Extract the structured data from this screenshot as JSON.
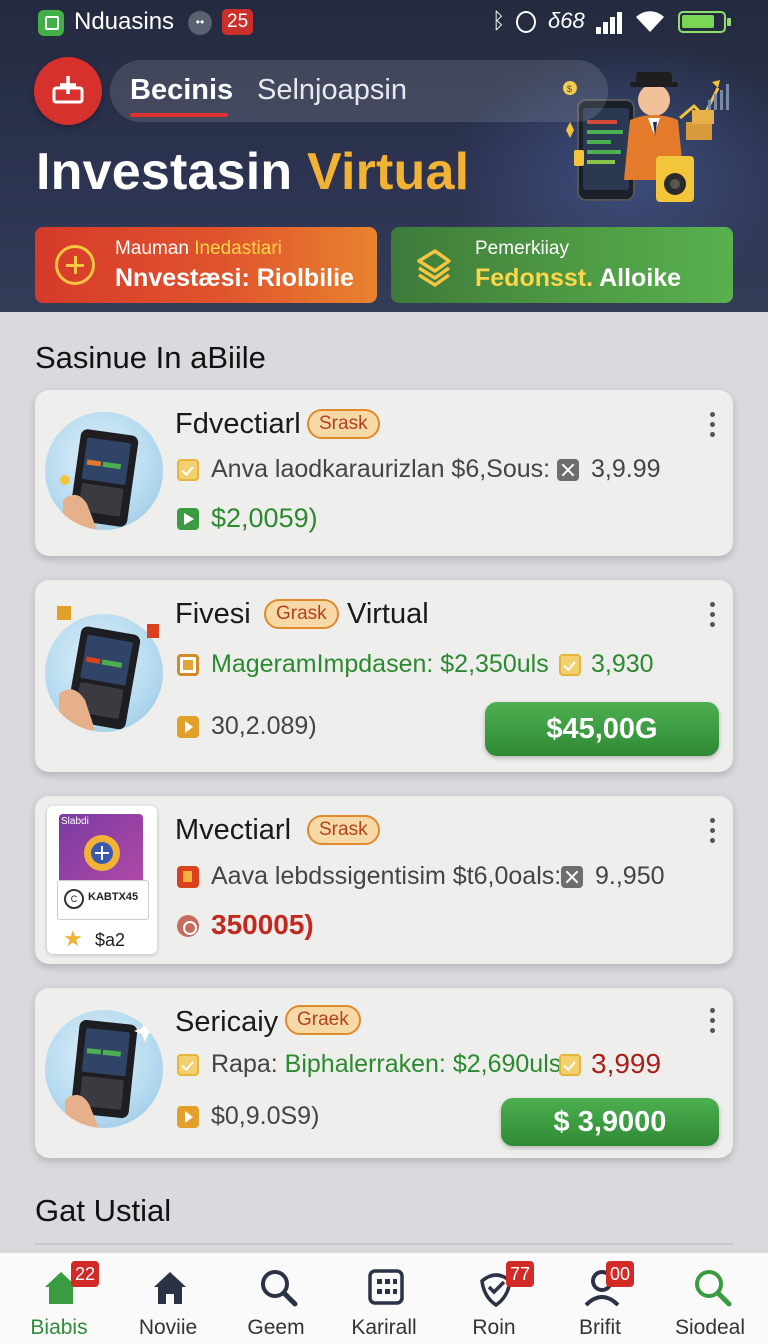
{
  "status_bar": {
    "app_name": "Nduasins",
    "dots": "••",
    "badge": "25",
    "time": "δ68"
  },
  "header": {
    "tabs": [
      {
        "label": "Becinis",
        "active": true
      },
      {
        "label": "Selnjoapsin",
        "active": false
      }
    ],
    "title_main": "Investasin",
    "title_accent": "Virtual",
    "accent_color": "#f2b233",
    "promos": [
      {
        "line1_prefix": "Mauman",
        "line1_highlight": "Inedastiari",
        "line2": "Nnvestæsi: Riolbilie",
        "icon": "plus-circle-icon",
        "color": "#d63a2a"
      },
      {
        "line1": "Pemerkiiay",
        "line2_highlight": "Fedonsst.",
        "line2_rest": "Alloike",
        "icon": "layers-icon",
        "color": "#4d9843"
      }
    ]
  },
  "sections": {
    "first_title": "Sasinue In aBiile",
    "second_title": "Gat Ustial"
  },
  "cards": [
    {
      "title": "Fdvectiarl",
      "badge": "Srask",
      "row1_text": "Anva laodkaraurizlan $6,Sous:",
      "row1_value": "3,9.99",
      "row2_text": "$2,0059)"
    },
    {
      "title": "Fivesi",
      "badge": "Grask",
      "title_suffix": "Virtual",
      "row1_text": "MageramImpdasen: $2,350uls",
      "row1_value": "3,930",
      "row2_text": "30,2.089)",
      "button": "$45,00G"
    },
    {
      "title": "Mvectiarl",
      "badge": "Srask",
      "thumb_top": "Slabdi",
      "thumb_code": "KABTX45",
      "thumb_price": "$a2",
      "row1_text": "Aava lebdssigentisim $t6,0oals:",
      "row1_value": "9.,950",
      "row2_text": "350005)"
    },
    {
      "title": "Sericaiy",
      "badge": "Graek",
      "row1_text_prefix": "Rapa:",
      "row1_text_green": "Biphalerraken: $2,690uls",
      "row1_value": "3,999",
      "row2_text": "$0,9.0S9)",
      "button": "$ 3,9000"
    }
  ],
  "bottom_nav": [
    {
      "label": "Biabis",
      "icon": "home-icon",
      "badge": "22",
      "active": true
    },
    {
      "label": "Noviie",
      "icon": "home-icon",
      "badge": null,
      "active": false
    },
    {
      "label": "Geem",
      "icon": "search-icon",
      "badge": null,
      "active": false
    },
    {
      "label": "Karirall",
      "icon": "grid-icon",
      "badge": null,
      "active": false
    },
    {
      "label": "Roin",
      "icon": "shield-check-icon",
      "badge": "77",
      "active": false
    },
    {
      "label": "Brifit",
      "icon": "profile-icon",
      "badge": "00",
      "active": false
    },
    {
      "label": "Siodeal",
      "icon": "search-icon",
      "badge": null,
      "active": false
    }
  ],
  "colors": {
    "primary_green": "#2e8b36",
    "primary_red": "#d6312c",
    "header_bg": "#2c3350"
  }
}
